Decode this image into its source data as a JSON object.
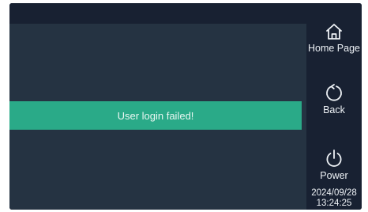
{
  "message": {
    "text": "User login failed!"
  },
  "sidebar": {
    "home_label": "Home Page",
    "back_label": "Back",
    "power_label": "Power",
    "date": "2024/09/28",
    "time": "13:24:25"
  },
  "icons": {
    "home": "home-icon",
    "back": "back-arrow-icon",
    "power": "power-icon"
  },
  "colors": {
    "background": "#1c2535",
    "panel": "#253342",
    "banner": "#2aaa88",
    "text": "#eef2f6"
  }
}
